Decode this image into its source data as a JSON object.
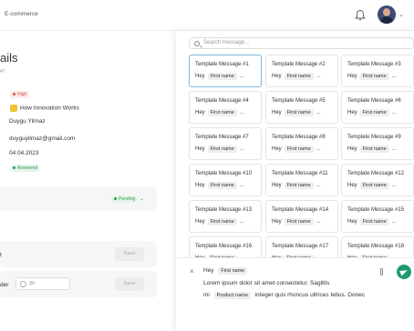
{
  "header": {
    "breadcrumb": "E-commerce",
    "bell_icon": "bell-icon",
    "avatar_icon": "user-avatar",
    "avatar_caret": "⌄"
  },
  "background_page": {
    "title": "ails",
    "subtitle": "47",
    "priority": "High",
    "company": "How Innovation Works",
    "customer_name": "Duygu Yilmaz",
    "email": "duyguyilmaz@gmail.com",
    "date": "04.04.2023",
    "status": "Answered",
    "card_status": "Pending",
    "row1_label": "t",
    "row1_button": "Save",
    "row2_label": "der",
    "row2_input": "30",
    "row2_button": "Save"
  },
  "panel": {
    "search_placeholder": "Search message...",
    "templates": [
      {
        "name": "Template Message #1",
        "greeting": "Hey",
        "chip": "First name",
        "more": "..."
      },
      {
        "name": "Template Message #2",
        "greeting": "Hey",
        "chip": "First name",
        "more": "..."
      },
      {
        "name": "Template Message #3",
        "greeting": "Hey",
        "chip": "First name",
        "more": "..."
      },
      {
        "name": "Template Message #4",
        "greeting": "Hey",
        "chip": "First name",
        "more": "..."
      },
      {
        "name": "Template Message #5",
        "greeting": "Hey",
        "chip": "First name",
        "more": "..."
      },
      {
        "name": "Template Message #6",
        "greeting": "Hey",
        "chip": "First name",
        "more": "..."
      },
      {
        "name": "Template Message #7",
        "greeting": "Hey",
        "chip": "First name",
        "more": "..."
      },
      {
        "name": "Template Message #8",
        "greeting": "Hey",
        "chip": "First name",
        "more": "..."
      },
      {
        "name": "Template Message #9",
        "greeting": "Hey",
        "chip": "First name",
        "more": "..."
      },
      {
        "name": "Template Message #10",
        "greeting": "Hey",
        "chip": "First name",
        "more": "..."
      },
      {
        "name": "Template Message #11",
        "greeting": "Hey",
        "chip": "First name",
        "more": "..."
      },
      {
        "name": "Template Message #12",
        "greeting": "Hey",
        "chip": "First name",
        "more": "..."
      },
      {
        "name": "Template Message #13",
        "greeting": "Hey",
        "chip": "First name",
        "more": "..."
      },
      {
        "name": "Template Message #14",
        "greeting": "Hey",
        "chip": "First name",
        "more": "..."
      },
      {
        "name": "Template Message #15",
        "greeting": "Hey",
        "chip": "First name",
        "more": "..."
      },
      {
        "name": "Template Message #16",
        "greeting": "Hey",
        "chip": "First name",
        "more": "..."
      },
      {
        "name": "Template Message #17",
        "greeting": "Hey",
        "chip": "First name",
        "more": "..."
      },
      {
        "name": "Template Message #18",
        "greeting": "Hey",
        "chip": "First name",
        "more": "..."
      }
    ],
    "selected_index": 0,
    "compose": {
      "close_icon": "×",
      "line1_text": "Hey",
      "line1_chip": "First name",
      "line2_text": "Lorem ipsum dolor sit amet consectetur. Sagittis",
      "line3_prefix": "mi",
      "line3_chip": "Product name",
      "line3_text": "integer quis rhoncus ultrices tellus. Donec",
      "attach_icon": "attach-icon",
      "send_icon": "send-icon"
    }
  },
  "colors": {
    "accent_green": "#1e9a73",
    "selected_border": "#7fb8d8",
    "high_red": "#d9534f",
    "status_green": "#2e9d4c"
  }
}
